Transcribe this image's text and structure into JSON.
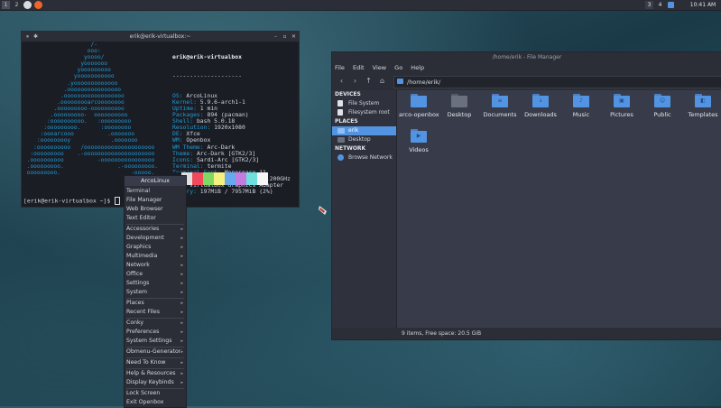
{
  "panel": {
    "workspaces": [
      "1",
      "2"
    ],
    "right_items": [
      "3",
      "4"
    ],
    "clock": "10:41 AM"
  },
  "terminal": {
    "title": "erik@erik-virtualbox:~",
    "ascii": "                    /-\n                   ooo:\n                  yoooo/\n                 yooooooo\n                yooooooooo\n               yooooooooooo\n             .yooooooooooooo\n            .oooooooooooooooo\n           .oooooooooooooooooo\n          .ooooooooarcoooooooo\n         .ooooooooo-oooooooooo\n        .ooooooooo-  oooooooooo\n       :oooooooooo.   :ooooooooo\n      :ooooooooo.      :oooooooo\n     :oooarcooo          .ooooooo\n    :ooooooooy            .ooooooo\n   :oooooooooo   /ooooooooooooooooooooo\n  :ooooooooo    .-ooooooooooooooooooooo\n .oooooooooo          -oooooooooooooooo\n .ooooooooo.                .-ooooooooo.\n ooooooooo.                     -ooooo.",
    "user_host": "erik@erik-virtualbox",
    "separator": "--------------------",
    "info": [
      {
        "k": "OS:",
        "v": " ArcoLinux"
      },
      {
        "k": "Kernel:",
        "v": " 5.9.6-arch1-1"
      },
      {
        "k": "Uptime:",
        "v": " 1 min"
      },
      {
        "k": "Packages:",
        "v": " 894 (pacman)"
      },
      {
        "k": "Shell:",
        "v": " bash 5.0.18"
      },
      {
        "k": "Resolution:",
        "v": " 1920x1080"
      },
      {
        "k": "DE:",
        "v": " Xfce"
      },
      {
        "k": "WM:",
        "v": " Openbox"
      },
      {
        "k": "WM Theme:",
        "v": " Arc-Dark"
      },
      {
        "k": "Theme:",
        "v": " Arc-Dark [GTK2/3]"
      },
      {
        "k": "Icons:",
        "v": " Sardi-Arc [GTK2/3]"
      },
      {
        "k": "Terminal:",
        "v": " termite"
      },
      {
        "k": "Terminal Font:",
        "v": " Monospace 11"
      },
      {
        "k": "CPU:",
        "v": " Intel i7-7700K (4) @ 4.200GHz"
      },
      {
        "k": "GPU:",
        "v": " VirtualBox Graphics Adapter"
      },
      {
        "k": "Memory:",
        "v": " 197MiB / 7957MiB (2%)"
      }
    ],
    "prompt": "[erik@erik-virtualbox ~]$ ",
    "swatch_colors": [
      "#1b1d24",
      "#e0e0e0",
      "#f04a5c",
      "#7fd962",
      "#f6f17e",
      "#67a9f0",
      "#c37de0",
      "#6ee0dd",
      "#f5f5f5"
    ]
  },
  "file_manager": {
    "title": "/home/erik - File Manager",
    "menu": [
      "File",
      "Edit",
      "View",
      "Go",
      "Help"
    ],
    "path": "/home/erik/",
    "sidebar": {
      "devices_header": "DEVICES",
      "devices": [
        "File System",
        "Filesystem root"
      ],
      "places_header": "PLACES",
      "places": [
        "erik",
        "Desktop"
      ],
      "network_header": "NETWORK",
      "network": [
        "Browse Network"
      ]
    },
    "items": [
      {
        "label": "arco-openbox",
        "glyph": ""
      },
      {
        "label": "Desktop",
        "glyph": ""
      },
      {
        "label": "Documents",
        "glyph": "≡"
      },
      {
        "label": "Downloads",
        "glyph": "↓"
      },
      {
        "label": "Music",
        "glyph": "♪"
      },
      {
        "label": "Pictures",
        "glyph": "▣"
      },
      {
        "label": "Public",
        "glyph": "☺"
      },
      {
        "label": "Templates",
        "glyph": "◧"
      },
      {
        "label": "Videos",
        "glyph": "▶"
      }
    ],
    "status": "9 items, Free space: 20.5 GiB"
  },
  "menu": {
    "title": "ArcoLinux",
    "groups": [
      [
        {
          "label": "Terminal",
          "sub": false
        },
        {
          "label": "File Manager",
          "sub": false
        },
        {
          "label": "Web Browser",
          "sub": false
        },
        {
          "label": "Text Editor",
          "sub": false
        }
      ],
      [
        {
          "label": "Accessories",
          "sub": true
        },
        {
          "label": "Development",
          "sub": true
        },
        {
          "label": "Graphics",
          "sub": true
        },
        {
          "label": "Multimedia",
          "sub": true
        },
        {
          "label": "Network",
          "sub": true
        },
        {
          "label": "Office",
          "sub": true
        },
        {
          "label": "Settings",
          "sub": true
        },
        {
          "label": "System",
          "sub": true
        }
      ],
      [
        {
          "label": "Places",
          "sub": true
        },
        {
          "label": "Recent Files",
          "sub": true
        }
      ],
      [
        {
          "label": "Conky",
          "sub": true
        },
        {
          "label": "Preferences",
          "sub": true
        },
        {
          "label": "System Settings",
          "sub": true
        }
      ],
      [
        {
          "label": "Obmenu-Generator",
          "sub": true
        }
      ],
      [
        {
          "label": "Need To Know",
          "sub": true
        }
      ],
      [
        {
          "label": "Help & Resources",
          "sub": true
        },
        {
          "label": "Display Keybinds",
          "sub": true
        }
      ],
      [
        {
          "label": "Lock Screen",
          "sub": false
        },
        {
          "label": "Exit Openbox",
          "sub": false
        }
      ]
    ]
  }
}
